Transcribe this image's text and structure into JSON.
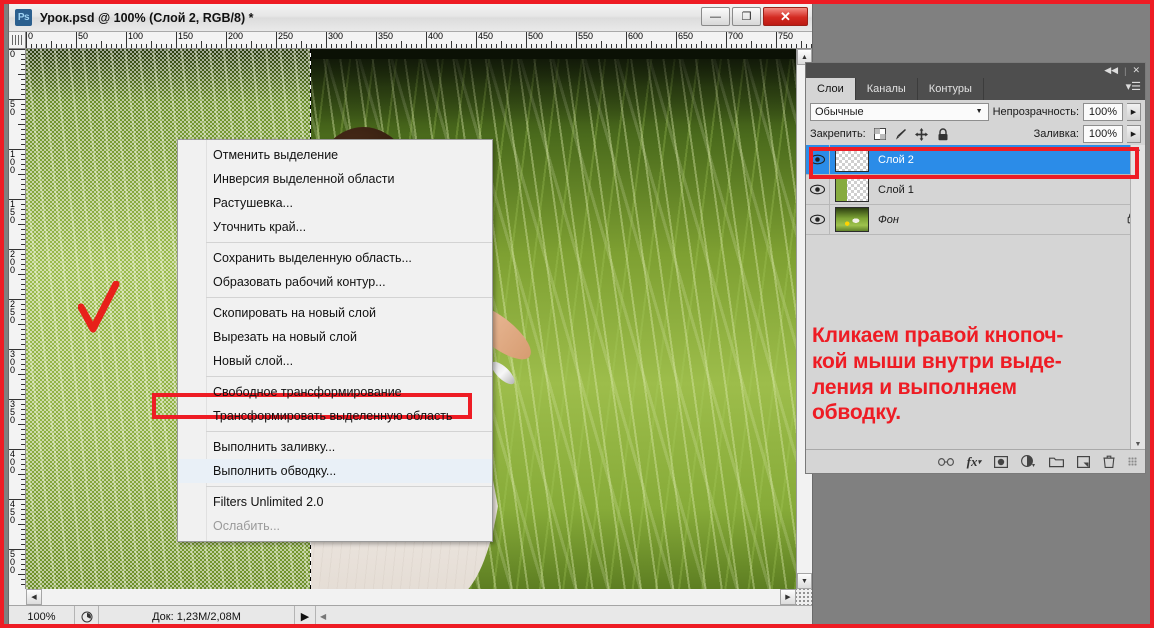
{
  "app": {
    "title": "Урок.psd @ 100% (Слой 2, RGB/8) *",
    "logo_text": "Ps",
    "window_controls": {
      "minimize": "—",
      "maximize": "❐",
      "close": "✕"
    }
  },
  "rulers": {
    "horizontal_ticks": [
      "0",
      "50",
      "100",
      "150",
      "200",
      "250",
      "300",
      "350",
      "400",
      "450",
      "500",
      "550",
      "600",
      "650",
      "700",
      "750"
    ],
    "vertical_ticks": [
      "0",
      "50",
      "100",
      "150",
      "200",
      "250",
      "300",
      "350",
      "400",
      "450",
      "500"
    ]
  },
  "status_bar": {
    "zoom": "100%",
    "preview_icon": "clock-icon",
    "doc_info": "Док: 1,23M/2,08M",
    "arrow": "▶",
    "scroll_arrow": "◀"
  },
  "context_menu": {
    "items": [
      {
        "label": "Отменить выделение",
        "state": "normal"
      },
      {
        "label": "Инверсия выделенной области",
        "state": "normal"
      },
      {
        "label": "Растушевка...",
        "state": "normal"
      },
      {
        "label": "Уточнить край...",
        "state": "normal"
      },
      {
        "separator": true
      },
      {
        "label": "Сохранить выделенную область...",
        "state": "normal"
      },
      {
        "label": "Образовать рабочий контур...",
        "state": "normal"
      },
      {
        "separator": true
      },
      {
        "label": "Скопировать на новый слой",
        "state": "normal"
      },
      {
        "label": "Вырезать на новый слой",
        "state": "normal"
      },
      {
        "label": "Новый слой...",
        "state": "normal"
      },
      {
        "separator": true
      },
      {
        "label": "Свободное трансформирование",
        "state": "normal"
      },
      {
        "label": "Трансформировать выделенную область",
        "state": "normal"
      },
      {
        "separator": true
      },
      {
        "label": "Выполнить заливку...",
        "state": "normal"
      },
      {
        "label": "Выполнить обводку...",
        "state": "highlight"
      },
      {
        "separator": true
      },
      {
        "label": "Filters Unlimited 2.0",
        "state": "normal"
      },
      {
        "label": "Ослабить...",
        "state": "disabled"
      }
    ]
  },
  "layers_panel": {
    "tabs": [
      {
        "label": "Слои",
        "active": true
      },
      {
        "label": "Каналы",
        "active": false
      },
      {
        "label": "Контуры",
        "active": false
      }
    ],
    "collapse_icon": "◀◀",
    "close_icon": "✕",
    "menu_icon": "panel-menu-icon",
    "blend_mode": "Обычные",
    "opacity_label": "Непрозрачность:",
    "opacity_value": "100%",
    "lock_label": "Закрепить:",
    "lock_icons": [
      "transparency-lock-icon",
      "brush-lock-icon",
      "move-lock-icon",
      "all-lock-icon"
    ],
    "fill_label": "Заливка:",
    "fill_value": "100%",
    "layers": [
      {
        "name": "Слой 2",
        "selected": true,
        "visible": true,
        "thumb": "empty",
        "locked": false
      },
      {
        "name": "Слой 1",
        "selected": false,
        "visible": true,
        "thumb": "green-strip",
        "locked": false
      },
      {
        "name": "Фон",
        "selected": false,
        "visible": true,
        "thumb": "photo",
        "locked": true
      }
    ],
    "bottom_icons": [
      "link-icon",
      "fx-icon",
      "mask-icon",
      "adjustment-icon",
      "group-icon",
      "new-layer-icon",
      "delete-icon"
    ]
  },
  "annotation": {
    "color": "#ee1c24",
    "lines": [
      "Кликаем правой кнопоч-",
      "кой мыши внутри выде-",
      "ления и выполняем",
      "обводку."
    ]
  },
  "canvas_marks": {
    "checkmark": "red-checkmark",
    "selection_marquee": "marching-ants-line"
  }
}
